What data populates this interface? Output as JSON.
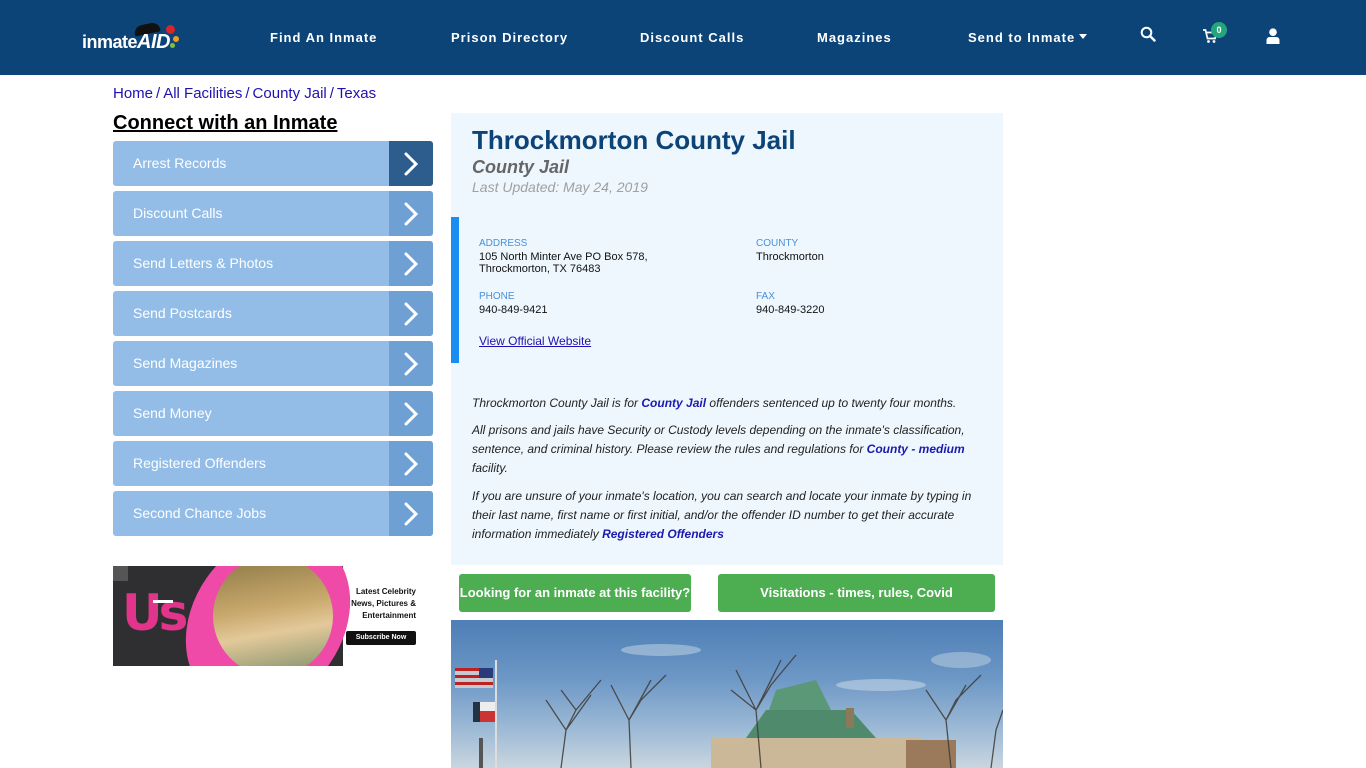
{
  "header": {
    "logo": {
      "text_main": "inmate",
      "text_accent": "AID"
    },
    "nav": [
      {
        "label": "Find An Inmate"
      },
      {
        "label": "Prison Directory"
      },
      {
        "label": "Discount Calls"
      },
      {
        "label": "Magazines"
      },
      {
        "label": "Send to Inmate",
        "dropdown": true
      }
    ],
    "icons": {
      "search": "search-icon",
      "cart": "cart-icon",
      "user": "user-icon"
    },
    "cart_count": "0",
    "colors": {
      "bar": "#0c4478",
      "badge": "#22a67a"
    }
  },
  "breadcrumb": [
    {
      "label": "Home"
    },
    {
      "label": "All Facilities"
    },
    {
      "label": "County Jail"
    },
    {
      "label": "Texas"
    }
  ],
  "sidebar": {
    "title": "Connect with an Inmate",
    "items": [
      {
        "label": "Arrest Records",
        "active": true
      },
      {
        "label": "Discount Calls"
      },
      {
        "label": "Send Letters & Photos"
      },
      {
        "label": "Send Postcards"
      },
      {
        "label": "Send Magazines"
      },
      {
        "label": "Send Money"
      },
      {
        "label": "Registered Offenders"
      },
      {
        "label": "Second Chance Jobs"
      }
    ],
    "ad": {
      "brand": "Us",
      "line1": "Latest Celebrity",
      "line2": "News, Pictures &",
      "line3": "Entertainment",
      "button": "Subscribe Now"
    }
  },
  "facility": {
    "name": "Throckmorton County Jail",
    "type": "County Jail",
    "last_updated": "Last Updated: May 24, 2019",
    "address_label": "ADDRESS",
    "address_line1": "105 North Minter Ave PO Box 578,",
    "address_line2": "Throckmorton, TX 76483",
    "county_label": "COUNTY",
    "county": "Throckmorton",
    "phone_label": "PHONE",
    "phone": "940-849-9421",
    "fax_label": "FAX",
    "fax": "940-849-3220",
    "website_link": "View Official Website"
  },
  "description": {
    "p1_pre": "Throckmorton County Jail is for ",
    "p1_link": "County Jail",
    "p1_post": " offenders sentenced up to twenty four months.",
    "p2_pre": "All prisons and jails have Security or Custody levels depending on the inmate's classification, sentence, and criminal history. Please review the rules and regulations for ",
    "p2_link": "County - medium",
    "p2_post": " facility.",
    "p3_pre": "If you are unsure of your inmate's location, you can search and locate your inmate by typing in their last name, first name or first initial, and/or the offender ID number to get their accurate information immediately ",
    "p3_link": "Registered Offenders"
  },
  "actions": {
    "find_inmate": "Looking for an inmate at this facility?",
    "visitations": "Visitations - times, rules, Covid cancellations"
  },
  "photo": {
    "subject": "Throckmorton County courthouse with flags and bare trees"
  }
}
